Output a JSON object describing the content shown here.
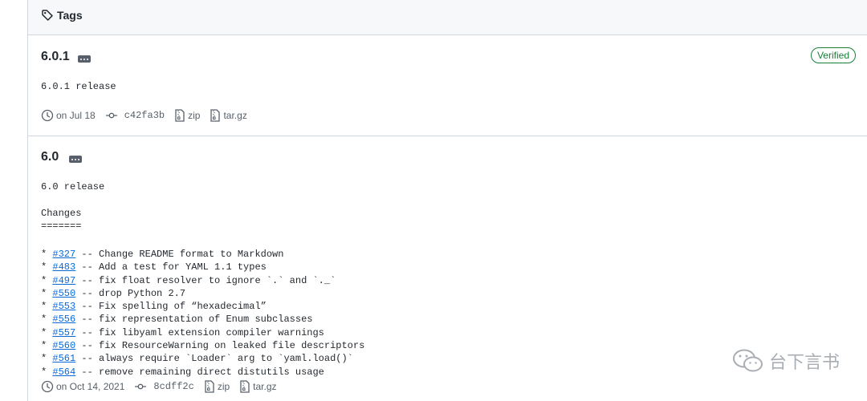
{
  "header": {
    "tags_label": "Tags"
  },
  "releases": [
    {
      "version": "6.0.1",
      "badge": "Verified",
      "description": "6.0.1 release",
      "date": "on Jul 18",
      "commit": "c42fa3b",
      "zip": "zip",
      "targz": "tar.gz"
    },
    {
      "version": "6.0",
      "description": "6.0 release",
      "changes_heading": "Changes",
      "changes_underline": "=======",
      "changes": [
        {
          "bullet": "* ",
          "issue": "#327",
          "text": " -- Change README format to Markdown"
        },
        {
          "bullet": "* ",
          "issue": "#483",
          "text": " -- Add a test for YAML 1.1 types"
        },
        {
          "bullet": "* ",
          "issue": "#497",
          "text": " -- fix float resolver to ignore `.` and `._`"
        },
        {
          "bullet": "* ",
          "issue": "#550",
          "text": " -- drop Python 2.7"
        },
        {
          "bullet": "* ",
          "issue": "#553",
          "text": " -- Fix spelling of “hexadecimal”"
        },
        {
          "bullet": "* ",
          "issue": "#556",
          "text": " -- fix representation of Enum subclasses"
        },
        {
          "bullet": "* ",
          "issue": "#557",
          "text": " -- fix libyaml extension compiler warnings"
        },
        {
          "bullet": "* ",
          "issue": "#560",
          "text": " -- fix ResourceWarning on leaked file descriptors"
        },
        {
          "bullet": "* ",
          "issue": "#561",
          "text": " -- always require `Loader` arg to `yaml.load()`"
        },
        {
          "bullet": "* ",
          "issue": "#564",
          "text": " -- remove remaining direct distutils usage"
        }
      ],
      "date": "on Oct 14, 2021",
      "commit": "8cdff2c",
      "zip": "zip",
      "targz": "tar.gz"
    }
  ],
  "watermark": {
    "text": "台下言书"
  }
}
